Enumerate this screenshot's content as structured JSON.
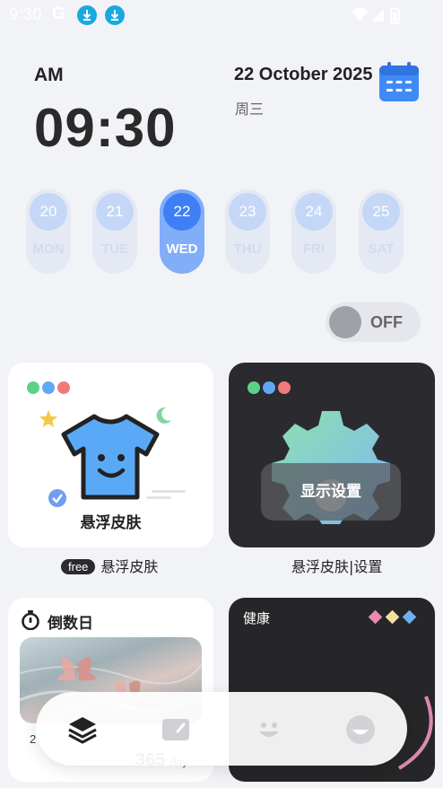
{
  "status_bar": {
    "time": "9:30",
    "google_letter": "G"
  },
  "clock": {
    "period": "AM",
    "time": "09:30",
    "date": "22 October 2025",
    "weekday_cn": "周三"
  },
  "week": {
    "days": [
      {
        "num": "20",
        "label": "MON",
        "active": false
      },
      {
        "num": "21",
        "label": "TUE",
        "active": false
      },
      {
        "num": "22",
        "label": "WED",
        "active": true
      },
      {
        "num": "23",
        "label": "THU",
        "active": false
      },
      {
        "num": "24",
        "label": "FRI",
        "active": false
      },
      {
        "num": "25",
        "label": "SAT",
        "active": false
      }
    ]
  },
  "toggle": {
    "label": "OFF",
    "state": "off"
  },
  "cards": {
    "skin": {
      "title": "悬浮皮肤",
      "caption_badge": "free",
      "caption": "悬浮皮肤"
    },
    "settings": {
      "button_label": "显示设置",
      "caption": "悬浮皮肤|设置"
    },
    "countdown": {
      "title": "倒数日",
      "date_text": "2",
      "count": "365",
      "unit": "day"
    },
    "health": {
      "title": "健康"
    }
  },
  "colors": {
    "accent_blue": "#3f7ff5",
    "dot_green": "#5fd08a",
    "dot_blue": "#5fa8f5",
    "dot_red": "#f07a7a",
    "diamond_pink": "#e98bb0",
    "diamond_yellow": "#f5dfa0",
    "diamond_blue": "#6eb0f0"
  },
  "dock": {
    "items": [
      "layers-icon",
      "widget-card-icon",
      "smile-icon",
      "emoji-face-icon"
    ]
  }
}
